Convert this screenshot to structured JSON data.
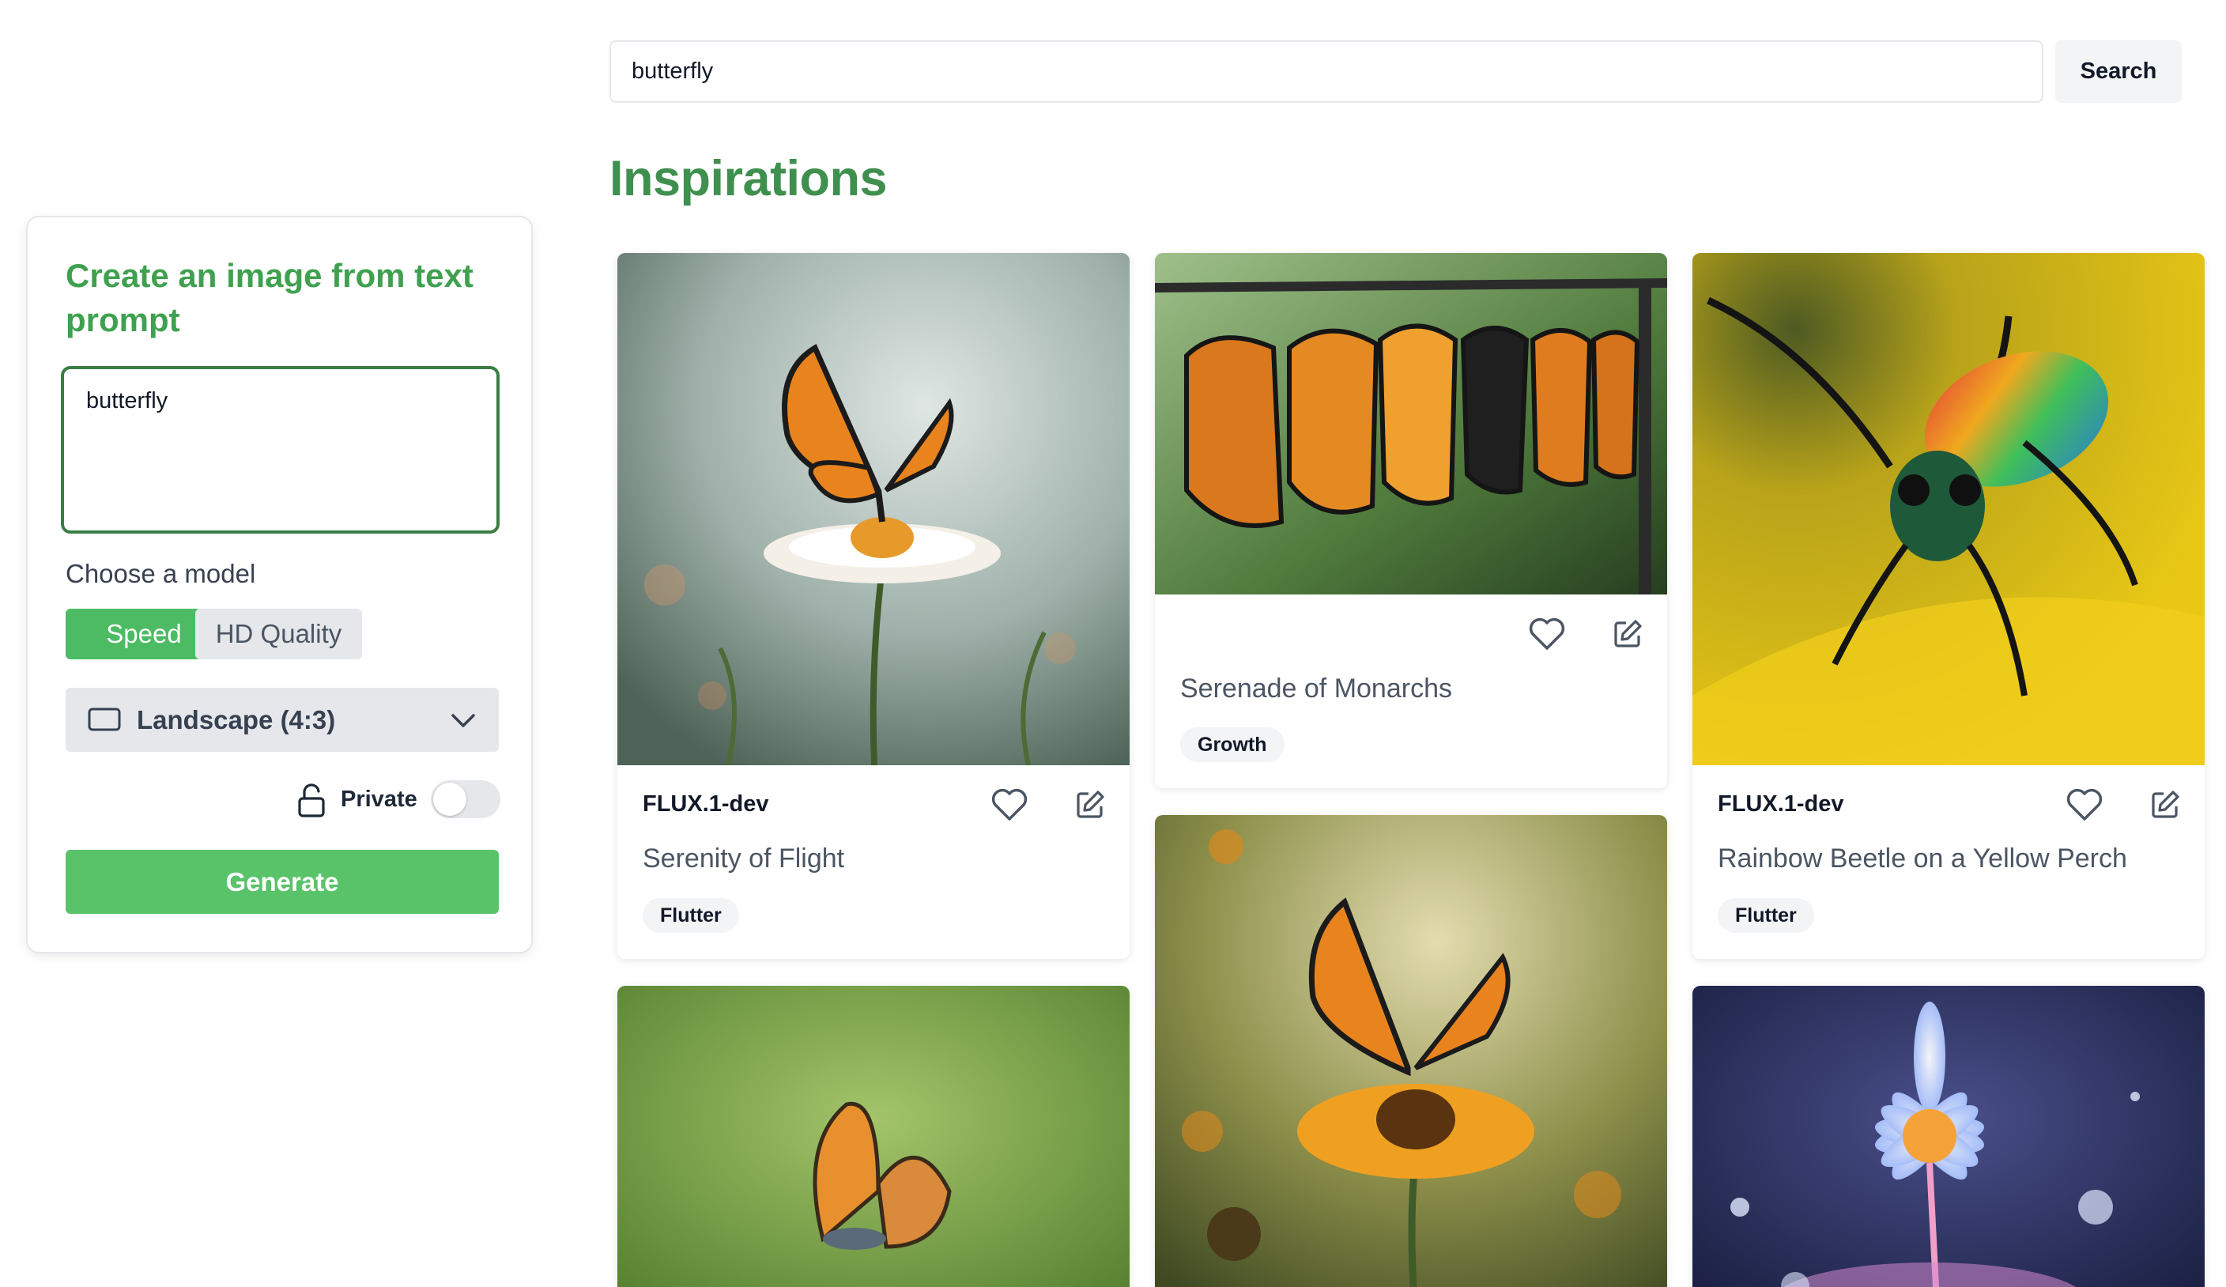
{
  "search": {
    "value": "butterfly",
    "button_label": "Search"
  },
  "page": {
    "title": "Inspirations"
  },
  "create_panel": {
    "title": "Create an image from text prompt",
    "prompt_value": "butterfly",
    "model_label": "Choose a model",
    "models": [
      "Speed",
      "HD Quality"
    ],
    "selected_model": "Speed",
    "aspect_ratio": "Landscape (4:3)",
    "private_label": "Private",
    "private_enabled": false,
    "generate_label": "Generate"
  },
  "gallery": {
    "cards": [
      {
        "model": "FLUX.1-dev",
        "title": "Serenity of Flight",
        "tag": "Flutter"
      },
      {
        "model": "",
        "title": "Serenade of Monarchs",
        "tag": "Growth"
      },
      {
        "model": "FLUX.1-dev",
        "title": "Rainbow Beetle on a Yellow Perch",
        "tag": "Flutter"
      },
      {
        "model": "",
        "title": "",
        "tag": ""
      },
      {
        "model": "",
        "title": "",
        "tag": ""
      },
      {
        "model": "",
        "title": "",
        "tag": ""
      }
    ]
  },
  "colors": {
    "accent_green": "#3fa14f",
    "button_green": "#59c36a",
    "title_green": "#3f8f4f"
  }
}
